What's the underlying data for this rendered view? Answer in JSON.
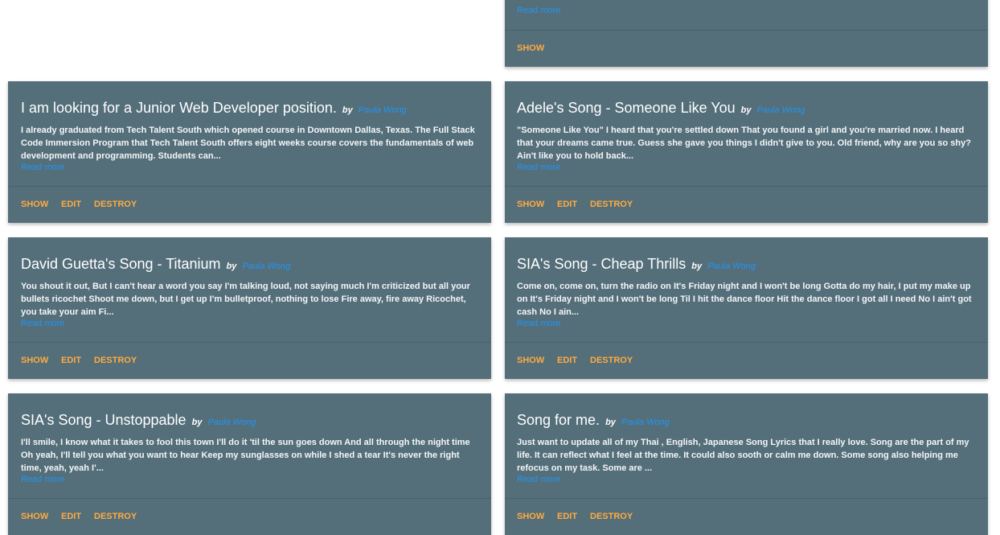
{
  "cards": [
    {
      "title": "",
      "author": "",
      "excerpt": "",
      "read_more": "Read more",
      "actions": {
        "show": "SHOW"
      }
    },
    {
      "title": "I am looking for a Junior Web Developer position.",
      "by": "by",
      "author": "Paula Wong",
      "excerpt": "I already graduated from Tech Talent South which opened course in Downtown Dallas, Texas. The Full Stack Code Immersion Program that Tech Talent South offers eight weeks course covers the fundamentals of web development and programming. Students can...",
      "read_more": "Read more",
      "actions": {
        "show": "SHOW",
        "edit": "EDIT",
        "destroy": "DESTROY"
      }
    },
    {
      "title": "Adele's Song - Someone Like You",
      "by": "by",
      "author": "Paula Wong",
      "excerpt": "\"Someone Like You\" I heard that you're settled down That you found a girl and you're married now. I heard that your dreams came true. Guess she gave you things I didn't give to you. Old friend, why are you so shy? Ain't like you to hold back...",
      "read_more": "Read more",
      "actions": {
        "show": "SHOW",
        "edit": "EDIT",
        "destroy": "DESTROY"
      }
    },
    {
      "title": "David Guetta's Song - Titanium",
      "by": "by",
      "author": "Paula Wong",
      "excerpt": "You shout it out, But I can't hear a word you say I'm talking loud, not saying much I'm criticized but all your bullets ricochet Shoot me down, but I get up I'm bulletproof, nothing to lose Fire away, fire away Ricochet, you take your aim Fi...",
      "read_more": "Read more",
      "actions": {
        "show": "SHOW",
        "edit": "EDIT",
        "destroy": "DESTROY"
      }
    },
    {
      "title": "SIA's Song - Cheap Thrills",
      "by": "by",
      "author": "Paula Wong",
      "excerpt": "Come on, come on, turn the radio on It's Friday night and I won't be long Gotta do my hair, I put my make up on It's Friday night and I won't be long Til I hit the dance floor Hit the dance floor I got all I need No I ain't got cash No I ain...",
      "read_more": "Read more",
      "actions": {
        "show": "SHOW",
        "edit": "EDIT",
        "destroy": "DESTROY"
      }
    },
    {
      "title": "SIA's Song - Unstoppable",
      "by": "by",
      "author": "Paula Wong",
      "excerpt": "I'll smile, I know what it takes to fool this town I'll do it 'til the sun goes down And all through the night time Oh yeah, I'll tell you what you want to hear Keep my sunglasses on while I shed a tear It's never the right time, yeah, yeah I'...",
      "read_more": "Read more",
      "actions": {
        "show": "SHOW",
        "edit": "EDIT",
        "destroy": "DESTROY"
      }
    },
    {
      "title": "Song for me.",
      "by": "by",
      "author": "Paula Wong",
      "excerpt": "Just want to update all of my Thai , English, Japanese Song Lyrics that I really love. Song are the part of my life. It can reflect what I feel at the time. It could also sooth or calm me down. Some song also helping me refocus on my task. Some are ...",
      "read_more": "Read more",
      "actions": {
        "show": "SHOW",
        "edit": "EDIT",
        "destroy": "DESTROY"
      }
    }
  ]
}
